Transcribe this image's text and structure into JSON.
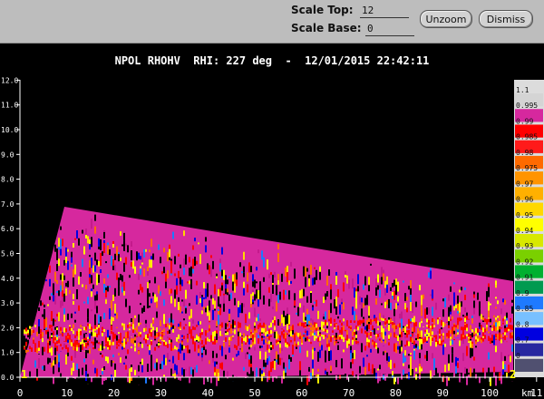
{
  "toolbar": {
    "scale_top_label": "Scale Top:",
    "scale_top_value": "12",
    "scale_base_label": "Scale Base:",
    "scale_base_value": "0",
    "unzoom_label": "Unzoom",
    "dismiss_label": "Dismiss"
  },
  "plot": {
    "title": "NPOL RHOHV  RHI: 227 deg  -  12/01/2015 22:42:11",
    "x_ticks": [
      "0",
      "10",
      "20",
      "30",
      "40",
      "50",
      "60",
      "70",
      "80",
      "90",
      "100",
      "11"
    ],
    "y_ticks": [
      "0.0",
      "1.0",
      "2.0",
      "3.0",
      "4.0",
      "5.0",
      "6.0",
      "7.0",
      "8.0",
      "9.0",
      "10.0",
      "11.0",
      "12.0"
    ],
    "x_unit": "km",
    "corner_left": "1",
    "corner_right": "2"
  },
  "legend": [
    {
      "label": "1.1",
      "color": "#d4d4d4"
    },
    {
      "label": "0.995",
      "color": "#d6289e"
    },
    {
      "label": "0.99",
      "color": "#ff0000"
    },
    {
      "label": "0.985",
      "color": "#ff1a1a"
    },
    {
      "label": "0.98",
      "color": "#ff6a00"
    },
    {
      "label": "0.975",
      "color": "#ff9400"
    },
    {
      "label": "0.97",
      "color": "#ffb000"
    },
    {
      "label": "0.96",
      "color": "#ffd800"
    },
    {
      "label": "0.95",
      "color": "#ffff00"
    },
    {
      "label": "0.94",
      "color": "#d8e800"
    },
    {
      "label": "0.93",
      "color": "#7ad000"
    },
    {
      "label": "0.92",
      "color": "#00b030"
    },
    {
      "label": "0.91",
      "color": "#009a50"
    },
    {
      "label": "0.9",
      "color": "#1e7aff"
    },
    {
      "label": "0.85",
      "color": "#78c0ff"
    },
    {
      "label": "0.8",
      "color": "#0000e0"
    },
    {
      "label": "0.7",
      "color": "#2828a0"
    },
    {
      "label": "0",
      "color": "#505070"
    }
  ]
}
